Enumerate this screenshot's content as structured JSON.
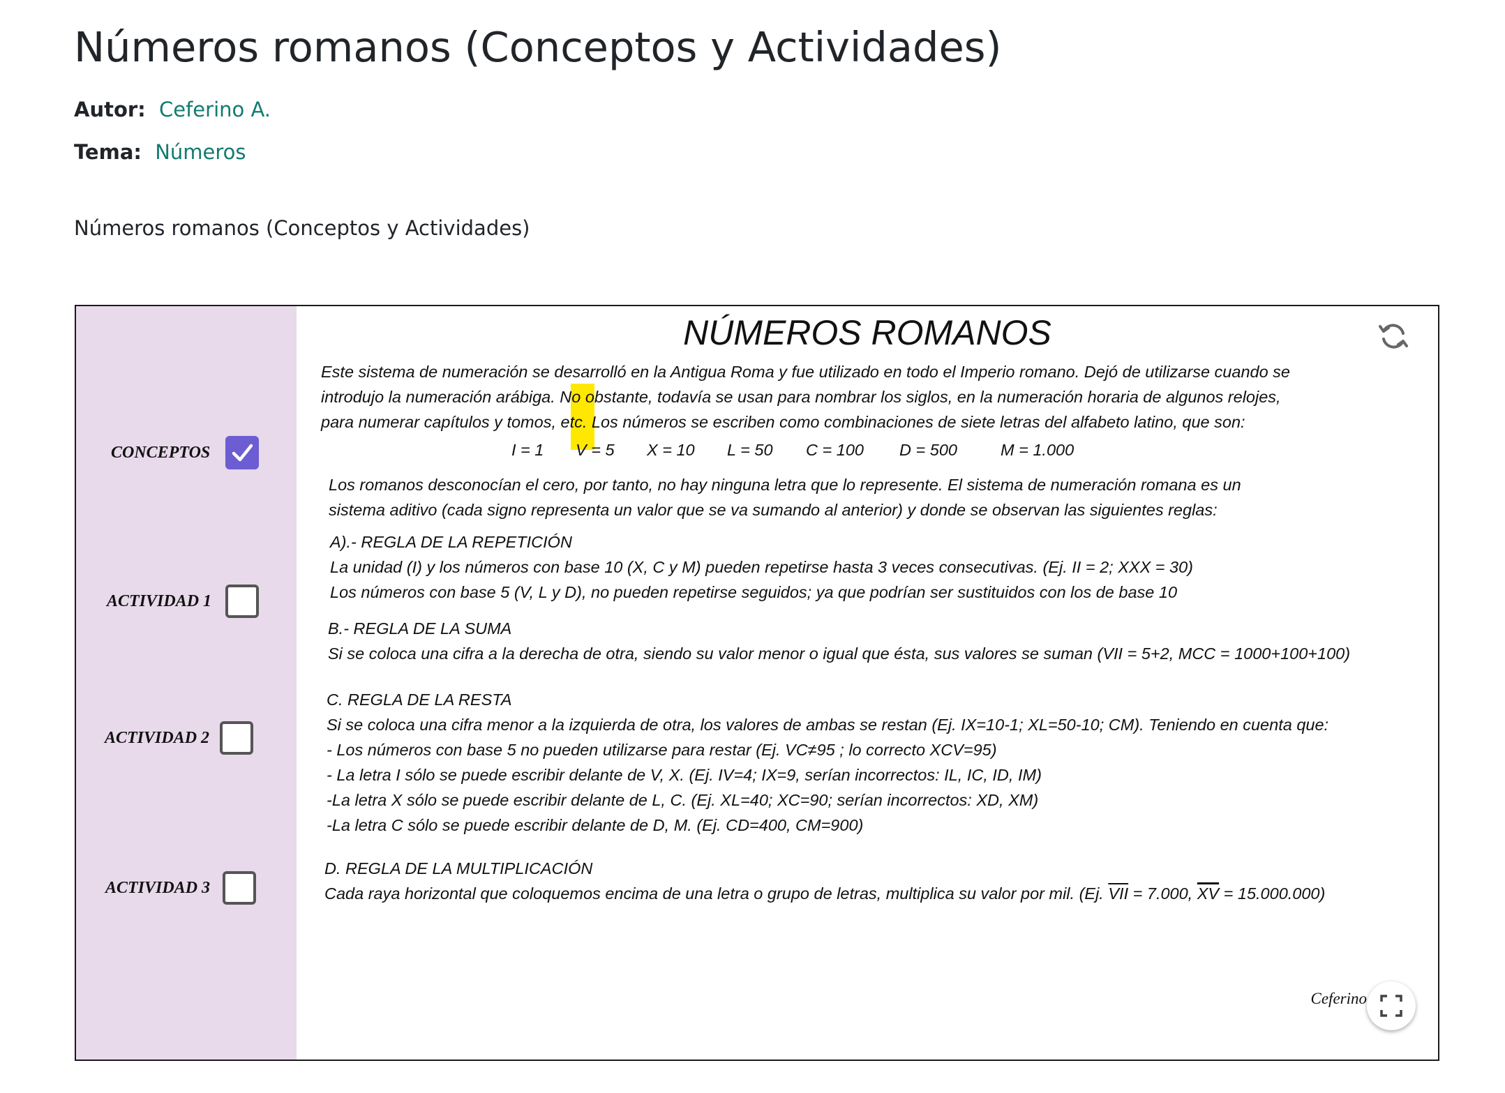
{
  "page": {
    "title": "Números romanos (Conceptos y Actividades)",
    "author_label": "Autor:",
    "author_name": "Ceferino A.",
    "topic_label": "Tema:",
    "topic_name": "Números",
    "subtitle": "Números romanos (Conceptos y Actividades)"
  },
  "colors": {
    "link": "#127b6f",
    "sidebar_bg": "#e8d9eb",
    "checkbox_checked": "#6c5dd3",
    "highlight": "#ffe800"
  },
  "sidebar": {
    "items": [
      {
        "label": "CONCEPTOS",
        "checked": true
      },
      {
        "label": "ACTIVIDAD 1",
        "checked": false
      },
      {
        "label": "ACTIVIDAD 2",
        "checked": false
      },
      {
        "label": "ACTIVIDAD 3",
        "checked": false
      }
    ]
  },
  "content": {
    "title": "NÚMEROS ROMANOS",
    "intro": [
      "Este sistema de numeración se desarrolló en la Antigua Roma y fue utilizado en todo el Imperio romano. Dejó de utilizarse cuando se",
      "introdujo la numeración arábiga. No obstante, todavía se usan para nombrar los siglos, en la numeración horaria de algunos relojes,",
      "para numerar capítulos y tomos, etc. Los números se escriben como combinaciones de siete letras del alfabeto latino, que son:"
    ],
    "values": [
      "I = 1",
      "V = 5",
      "X = 10",
      "L = 50",
      "C = 100",
      "D = 500",
      "M = 1.000"
    ],
    "para2": [
      "Los romanos desconocían el cero, por tanto, no hay ninguna letra que lo represente. El sistema de numeración romana es un",
      "sistema aditivo (cada signo representa un valor que se va sumando al anterior) y donde se observan las siguientes reglas:"
    ],
    "rule_a": {
      "heading": "A).- REGLA DE LA REPETICIÓN",
      "lines": [
        "La unidad (I) y los números con base 10 (X, C y M) pueden repetirse hasta 3 veces consecutivas. (Ej. II = 2;  XXX = 30)",
        "Los números con base 5 (V, L y D), no pueden repetirse seguidos; ya que podrían ser sustituidos con los de base 10"
      ]
    },
    "rule_b": {
      "heading": "B.- REGLA DE LA SUMA",
      "lines": [
        "Si se coloca una cifra a la derecha de otra, siendo su valor menor o igual que ésta, sus valores se suman (VII = 5+2, MCC = 1000+100+100)"
      ]
    },
    "rule_c": {
      "heading": "C. REGLA DE LA RESTA",
      "lines": [
        "Si se coloca una cifra menor a la izquierda de otra, los valores de ambas se restan (Ej. IX=10-1;  XL=50-10;  CM). Teniendo en cuenta que:",
        "- Los números con base 5 no pueden utilizarse para restar (Ej. VC≠95 ; lo correcto XCV=95)",
        "- La letra I sólo se puede escribir delante de V, X. (Ej. IV=4; IX=9, serían incorrectos: IL, IC, ID, IM)",
        "-La letra X sólo se puede escribir delante de L, C. (Ej. XL=40; XC=90; serían incorrectos: XD, XM)",
        "-La letra C sólo se puede escribir delante de D, M. (Ej. CD=400, CM=900)"
      ]
    },
    "rule_d": {
      "heading": "D. REGLA DE LA MULTIPLICACIÓN",
      "line_prefix": "Cada raya horizontal que coloquemos encima de una letra o grupo de letras, multiplica su valor por mil. (Ej. ",
      "ex1_numeral": "VII",
      "ex1_value": " = 7.000, ",
      "ex2_numeral": "XV",
      "ex2_value": " = 15.000.000)"
    },
    "signature": "Ceferino"
  },
  "icons": {
    "refresh": "refresh-icon",
    "fullscreen": "fullscreen-icon",
    "check": "check-icon"
  }
}
